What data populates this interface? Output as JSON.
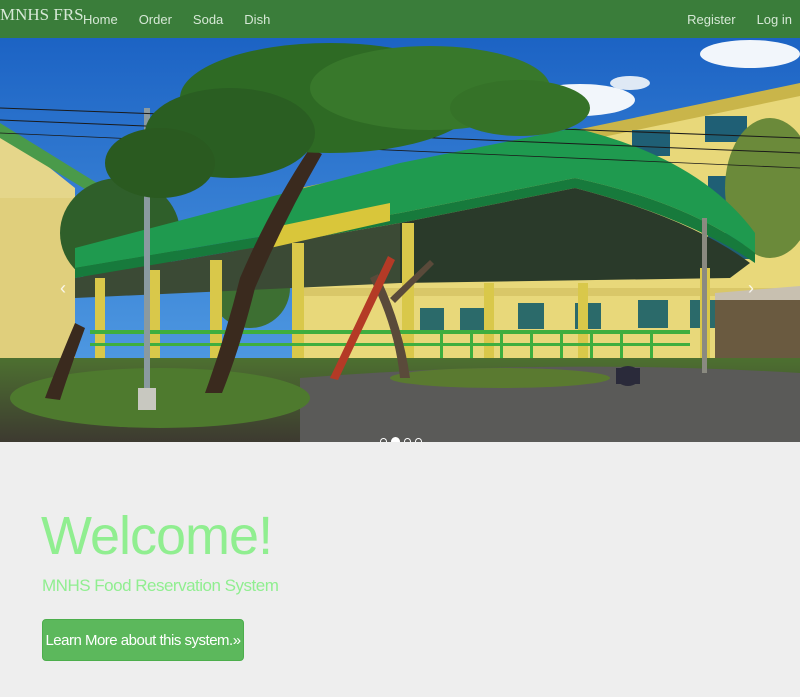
{
  "navbar": {
    "brand": "MNHS FRS",
    "left_links": [
      "Home",
      "Order",
      "Soda",
      "Dish"
    ],
    "right_links": [
      "Register",
      "Log in"
    ]
  },
  "carousel": {
    "prev_glyph": "‹",
    "next_glyph": "›",
    "slide_count": 4,
    "active_index": 1
  },
  "jumbotron": {
    "title": "Welcome!",
    "subtitle": "MNHS Food Reservation System",
    "button_label": "Learn More about this system.»"
  },
  "colors": {
    "navbar_bg": "#3a7d3a",
    "title_green": "#90ee90",
    "button_green": "#5cb85c"
  }
}
